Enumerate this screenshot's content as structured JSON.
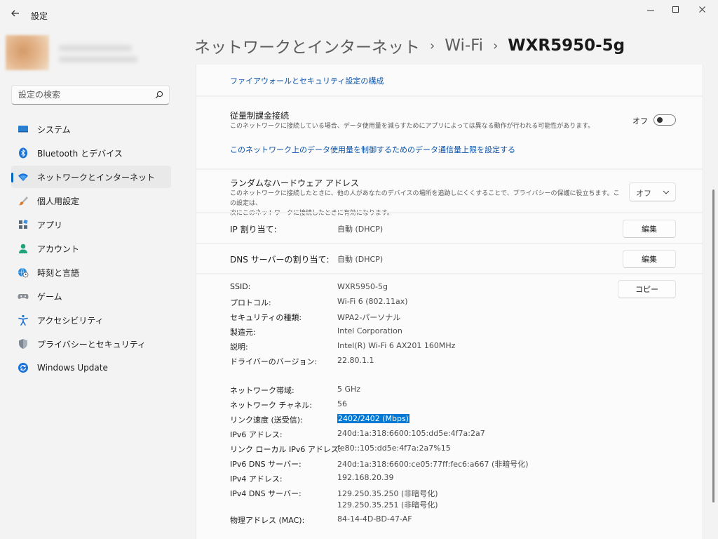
{
  "window": {
    "title": "設定"
  },
  "search": {
    "placeholder": "設定の検索"
  },
  "sidebar": {
    "items": [
      {
        "label": "システム",
        "icon": "monitor-icon",
        "active": false
      },
      {
        "label": "Bluetooth とデバイス",
        "icon": "bluetooth-icon",
        "active": false
      },
      {
        "label": "ネットワークとインターネット",
        "icon": "wifi-icon",
        "active": true
      },
      {
        "label": "個人用設定",
        "icon": "brush-icon",
        "active": false
      },
      {
        "label": "アプリ",
        "icon": "apps-icon",
        "active": false
      },
      {
        "label": "アカウント",
        "icon": "person-icon",
        "active": false
      },
      {
        "label": "時刻と言語",
        "icon": "globe-clock-icon",
        "active": false
      },
      {
        "label": "ゲーム",
        "icon": "gamepad-icon",
        "active": false
      },
      {
        "label": "アクセシビリティ",
        "icon": "accessibility-icon",
        "active": false
      },
      {
        "label": "プライバシーとセキュリティ",
        "icon": "shield-icon",
        "active": false
      },
      {
        "label": "Windows Update",
        "icon": "update-icon",
        "active": false
      }
    ]
  },
  "breadcrumb": {
    "items": [
      "ネットワークとインターネット",
      "Wi-Fi"
    ],
    "current": "WXR5950-5g"
  },
  "content": {
    "firewall_link": "ファイアウォールとセキュリティ設定の構成",
    "metered": {
      "title": "従量制課金接続",
      "description": "このネットワークに接続している場合、データ使用量を減らすためにアプリによっては異なる動作が行われる可能性があります。",
      "toggle_label": "オフ",
      "toggle_on": false,
      "data_limit_link": "このネットワーク上のデータ使用量を制御するためのデータ通信量上限を設定する"
    },
    "random_mac": {
      "title": "ランダムなハードウェア アドレス",
      "description_line1": "このネットワークに接続したときに、他の人があなたのデバイスの場所を追跡しにくくすることで、プライバシーの保護に役立ちます。この設定は、",
      "description_line2": "次にこのネットワークに接続したときに有効になります。",
      "selected": "オフ"
    },
    "ip_assignment": {
      "label": "IP 割り当て:",
      "value": "自動 (DHCP)",
      "button": "編集"
    },
    "dns_assignment": {
      "label": "DNS サーバーの割り当て:",
      "value": "自動 (DHCP)",
      "button": "編集"
    },
    "copy_button": "コピー",
    "properties": [
      {
        "label": "SSID:",
        "value": "WXR5950-5g"
      },
      {
        "label": "プロトコル:",
        "value": "Wi-Fi 6 (802.11ax)"
      },
      {
        "label": "セキュリティの種類:",
        "value": "WPA2-パーソナル"
      },
      {
        "label": "製造元:",
        "value": "Intel Corporation"
      },
      {
        "label": "説明:",
        "value": "Intel(R) Wi-Fi 6 AX201 160MHz"
      },
      {
        "label": "ドライバーのバージョン:",
        "value": "22.80.1.1"
      }
    ],
    "properties2": [
      {
        "label": "ネットワーク帯域:",
        "value": "5 GHz"
      },
      {
        "label": "ネットワーク チャネル:",
        "value": "56"
      },
      {
        "label": "リンク速度 (送受信):",
        "value": "2402/2402 (Mbps)",
        "selected": true
      },
      {
        "label": "IPv6 アドレス:",
        "value": "240d:1a:318:6600:105:dd5e:4f7a:2a7"
      },
      {
        "label": "リンク ローカル IPv6 アドレス:",
        "value": "fe80::105:dd5e:4f7a:2a7%15"
      },
      {
        "label": "IPv6 DNS サーバー:",
        "value": "240d:1a:318:6600:ce05:77ff:fec6:a667 (非暗号化)"
      },
      {
        "label": "IPv4 アドレス:",
        "value": "192.168.20.39"
      },
      {
        "label": "IPv4 DNS サーバー:",
        "value": "129.250.35.250 (非暗号化)",
        "value2": "129.250.35.251 (非暗号化)"
      },
      {
        "label": "物理アドレス (MAC):",
        "value": "84-14-4D-BD-47-AF"
      }
    ]
  }
}
